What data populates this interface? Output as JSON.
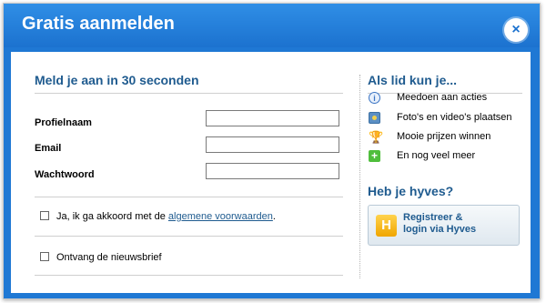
{
  "dialog": {
    "title": "Gratis aanmelden",
    "close_icon": "×"
  },
  "signup": {
    "heading": "Meld je aan in 30 seconden",
    "fields": [
      {
        "label": "Profielnaam",
        "value": ""
      },
      {
        "label": "Email",
        "value": ""
      },
      {
        "label": "Wachtwoord",
        "value": ""
      }
    ],
    "terms_prefix": "Ja, ik ga akkoord met de ",
    "terms_link": "algemene voorwaarden",
    "terms_suffix": ".",
    "newsletter_label": "Ontvang de nieuwsbrief"
  },
  "benefits": {
    "heading": "Als lid kun je...",
    "items": [
      {
        "icon": "info-icon",
        "text": "Meedoen aan acties"
      },
      {
        "icon": "photo-icon",
        "text": "Foto's en video's plaatsen"
      },
      {
        "icon": "trophy-icon",
        "text": "Mooie prijzen winnen"
      },
      {
        "icon": "plus-icon",
        "text": "En nog veel meer"
      }
    ]
  },
  "hyves": {
    "heading": "Heb je hyves?",
    "logo_letter": "H",
    "button_line1": "Registreer &",
    "button_line2": "login via Hyves"
  },
  "colors": {
    "title_bar": "#1c72cf",
    "heading_blue": "#1f5b8f",
    "link_blue": "#1f5b8f"
  }
}
